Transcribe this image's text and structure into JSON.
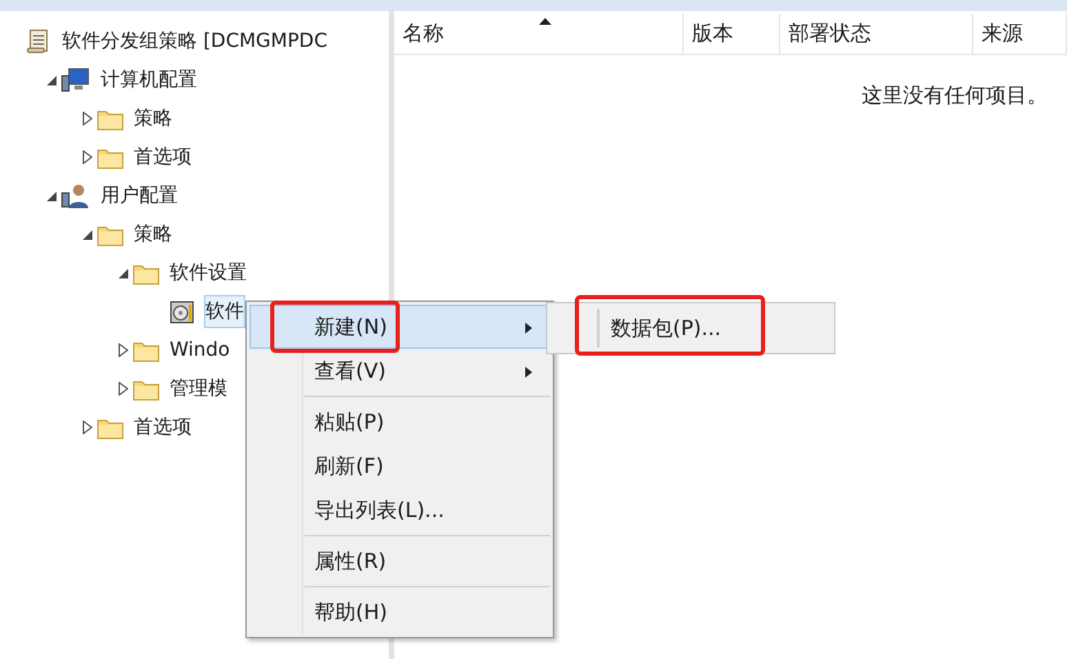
{
  "tree": [
    {
      "label": "软件分发组策略 [DCMGMPDC",
      "kind": "document",
      "selected": false,
      "children": [
        {
          "label": "计算机配置",
          "kind": "computer",
          "expanded": true,
          "selected": false,
          "children": [
            {
              "label": "策略",
              "kind": "folder",
              "expanded": false,
              "selected": false
            },
            {
              "label": "首选项",
              "kind": "folder",
              "expanded": false,
              "selected": false
            }
          ]
        },
        {
          "label": "用户配置",
          "kind": "users",
          "expanded": true,
          "selected": false,
          "children": [
            {
              "label": "策略",
              "kind": "folder",
              "expanded": true,
              "selected": false,
              "children": [
                {
                  "label": "软件设置",
                  "kind": "folder",
                  "expanded": true,
                  "selected": false,
                  "children": [
                    {
                      "label": "软件",
                      "kind": "installer",
                      "selected": true
                    }
                  ]
                },
                {
                  "label": "Windo",
                  "kind": "folder",
                  "expanded": false,
                  "selected": false
                },
                {
                  "label": "管理模",
                  "kind": "folder",
                  "expanded": false,
                  "selected": false
                }
              ]
            },
            {
              "label": "首选项",
              "kind": "folder",
              "expanded": false,
              "selected": false
            }
          ]
        }
      ]
    }
  ],
  "list": {
    "columns": [
      {
        "label": "名称",
        "sorted": true
      },
      {
        "label": "版本",
        "sorted": false
      },
      {
        "label": "部署状态",
        "sorted": false
      },
      {
        "label": "来源",
        "sorted": false
      }
    ],
    "empty_text": "这里没有任何项目。"
  },
  "context_menu": {
    "groups": [
      [
        {
          "label": "新建(N)",
          "submenu": true,
          "highlighted": true,
          "annotated": true
        },
        {
          "label": "查看(V)",
          "submenu": true,
          "highlighted": false,
          "annotated": false
        }
      ],
      [
        {
          "label": "粘贴(P)",
          "submenu": false,
          "highlighted": false,
          "annotated": false
        },
        {
          "label": "刷新(F)",
          "submenu": false,
          "highlighted": false,
          "annotated": false
        },
        {
          "label": "导出列表(L)...",
          "submenu": false,
          "highlighted": false,
          "annotated": false
        }
      ],
      [
        {
          "label": "属性(R)",
          "submenu": false,
          "highlighted": false,
          "annotated": false
        }
      ],
      [
        {
          "label": "帮助(H)",
          "submenu": false,
          "highlighted": false,
          "annotated": false
        }
      ]
    ]
  },
  "submenu": {
    "items": [
      {
        "label": "数据包(P)...",
        "annotated": true
      }
    ]
  }
}
